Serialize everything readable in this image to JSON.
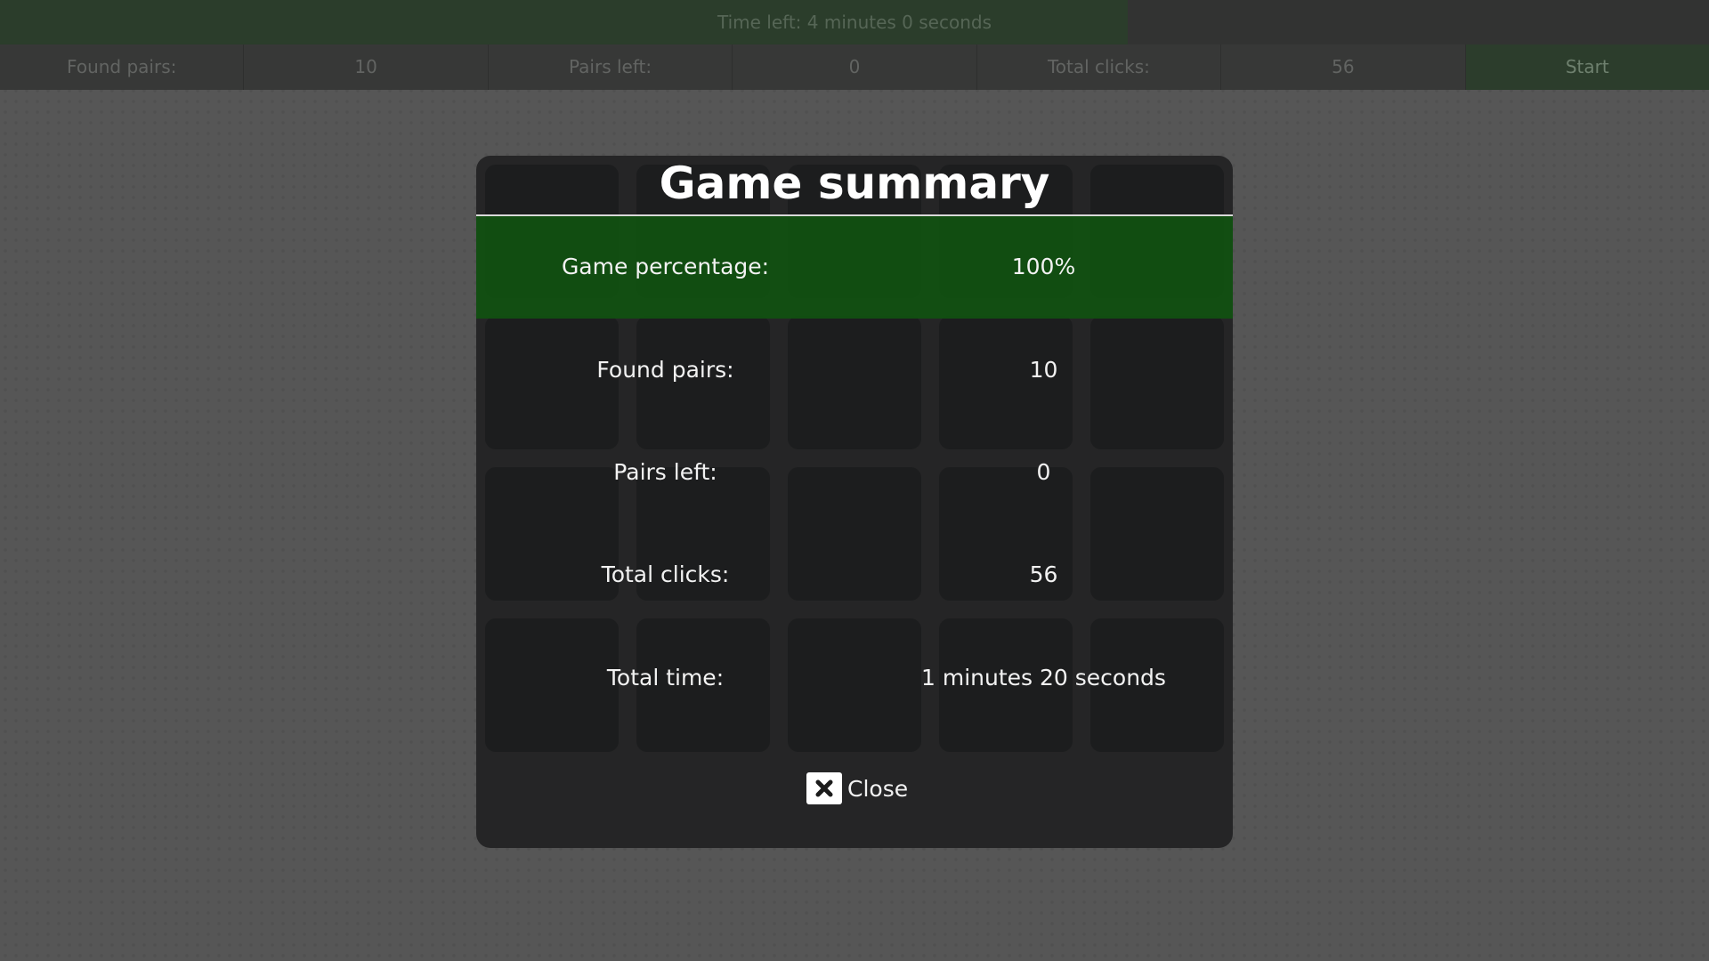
{
  "timer": {
    "label": "Time left: 4 minutes 0 seconds",
    "remaining_fraction": 0.66
  },
  "stats_bar": {
    "found_pairs_label": "Found pairs:",
    "found_pairs_value": "10",
    "pairs_left_label": "Pairs left:",
    "pairs_left_value": "0",
    "total_clicks_label": "Total clicks:",
    "total_clicks_value": "56",
    "start_label": "Start"
  },
  "summary": {
    "title": "Game summary",
    "rows": [
      {
        "label": "Game percentage:",
        "value": "100%"
      },
      {
        "label": "Found pairs:",
        "value": "10"
      },
      {
        "label": "Pairs left:",
        "value": "0"
      },
      {
        "label": "Total clicks:",
        "value": "56"
      },
      {
        "label": "Total time:",
        "value": "1 minutes 20 seconds"
      }
    ],
    "close_label": "Close"
  },
  "colors": {
    "background": "#565656",
    "highlight_green": "#115011",
    "modal": "#252526",
    "card": "#1c1d1e"
  }
}
